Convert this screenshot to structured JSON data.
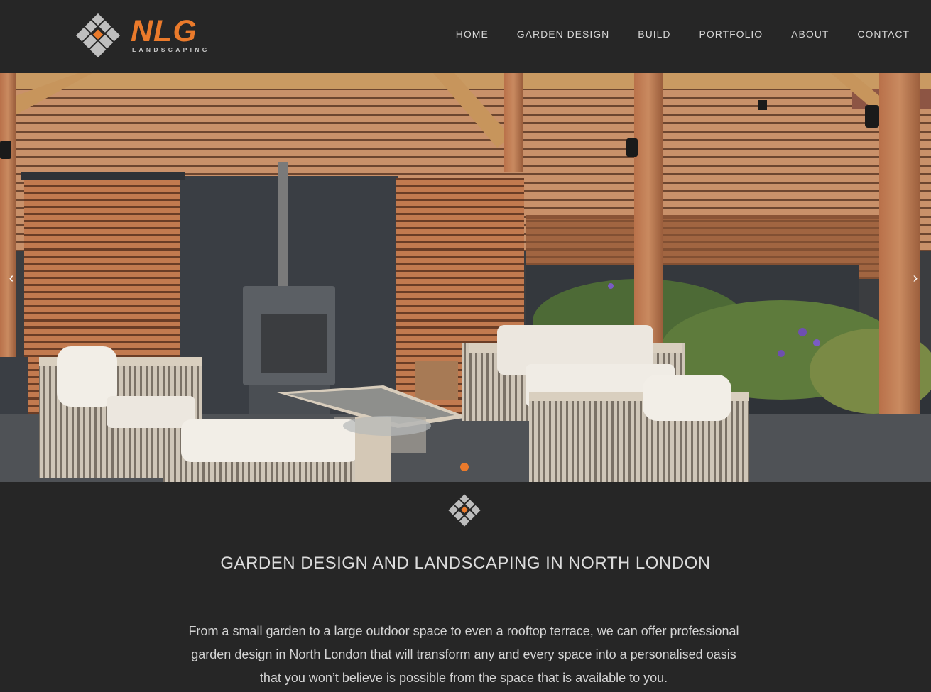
{
  "brand": {
    "name": "NLG",
    "tagline": "LANDSCAPING",
    "accent_color": "#ea7a2b",
    "logo_icon": "diamond-tile-logo"
  },
  "nav": {
    "items": [
      {
        "label": "HOME"
      },
      {
        "label": "GARDEN DESIGN"
      },
      {
        "label": "BUILD"
      },
      {
        "label": "PORTFOLIO"
      },
      {
        "label": "ABOUT"
      },
      {
        "label": "CONTACT"
      }
    ]
  },
  "slider": {
    "prev_icon": "chevron-left-icon",
    "next_icon": "chevron-right-icon",
    "prev_glyph": "‹",
    "next_glyph": "›",
    "active_slide": 1,
    "slide_count": 1,
    "image_subject": "garden terrace with pergola, slatted fencing, log burner and outdoor sofas"
  },
  "main": {
    "heading": "GARDEN DESIGN AND LANDSCAPING IN NORTH LONDON",
    "intro": "From a small garden to a large outdoor space to even a rooftop terrace, we can offer professional garden design in North London that will transform any and every space into a personalised oasis that you won’t believe is possible from the space that is available to you."
  }
}
